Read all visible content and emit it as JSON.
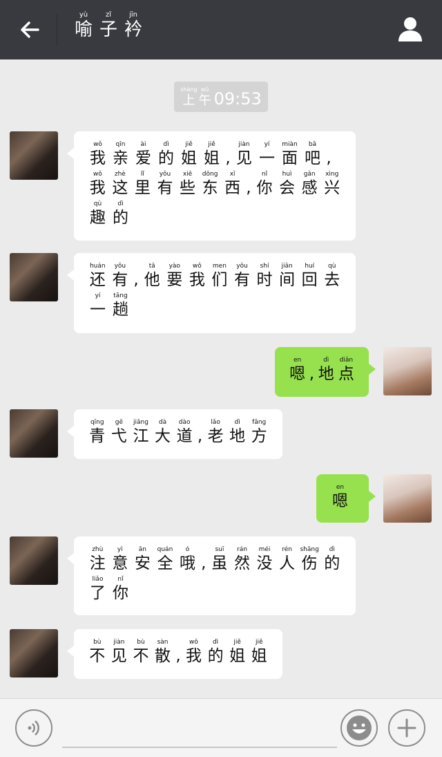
{
  "header": {
    "back_icon": "arrow-left-icon",
    "title": [
      {
        "py": "yù",
        "hz": "喻"
      },
      {
        "py": "zǐ",
        "hz": "子"
      },
      {
        "py": "jīn",
        "hz": "衿"
      }
    ],
    "profile_icon": "person-icon"
  },
  "timestamp": {
    "chars": [
      {
        "py": "shàng",
        "hz": "上"
      },
      {
        "py": "wǔ",
        "hz": "午"
      }
    ],
    "time": "09:53"
  },
  "messages": [
    {
      "side": "left",
      "lines": [
        [
          {
            "py": "wǒ",
            "hz": "我"
          },
          {
            "py": "qīn",
            "hz": "亲"
          },
          {
            "py": "ài",
            "hz": "爱"
          },
          {
            "py": "dì",
            "hz": "的"
          },
          {
            "py": "jiě",
            "hz": "姐"
          },
          {
            "py": "jiě",
            "hz": "姐"
          },
          {
            "py": "",
            "hz": ","
          },
          {
            "py": "jiàn",
            "hz": "见"
          },
          {
            "py": "yí",
            "hz": "一"
          },
          {
            "py": "miàn",
            "hz": "面"
          },
          {
            "py": "bā",
            "hz": "吧"
          },
          {
            "py": "",
            "hz": ","
          }
        ],
        [
          {
            "py": "wǒ",
            "hz": "我"
          },
          {
            "py": "zhè",
            "hz": "这"
          },
          {
            "py": "lǐ",
            "hz": "里"
          },
          {
            "py": "yǒu",
            "hz": "有"
          },
          {
            "py": "xiē",
            "hz": "些"
          },
          {
            "py": "dōng",
            "hz": "东"
          },
          {
            "py": "xī",
            "hz": "西"
          },
          {
            "py": "",
            "hz": ","
          },
          {
            "py": "nǐ",
            "hz": "你"
          },
          {
            "py": "huì",
            "hz": "会"
          },
          {
            "py": "gǎn",
            "hz": "感"
          },
          {
            "py": "xìng",
            "hz": "兴"
          }
        ],
        [
          {
            "py": "qù",
            "hz": "趣"
          },
          {
            "py": "dì",
            "hz": "的"
          }
        ]
      ]
    },
    {
      "side": "left",
      "lines": [
        [
          {
            "py": "huán",
            "hz": "还"
          },
          {
            "py": "yǒu",
            "hz": "有"
          },
          {
            "py": "",
            "hz": ","
          },
          {
            "py": "tā",
            "hz": "他"
          },
          {
            "py": "yào",
            "hz": "要"
          },
          {
            "py": "wǒ",
            "hz": "我"
          },
          {
            "py": "men",
            "hz": "们"
          },
          {
            "py": "yǒu",
            "hz": "有"
          },
          {
            "py": "shí",
            "hz": "时"
          },
          {
            "py": "jiān",
            "hz": "间"
          },
          {
            "py": "huí",
            "hz": "回"
          },
          {
            "py": "qù",
            "hz": "去"
          }
        ],
        [
          {
            "py": "yí",
            "hz": "一"
          },
          {
            "py": "tāng",
            "hz": "趟"
          }
        ]
      ]
    },
    {
      "side": "right",
      "lines": [
        [
          {
            "py": "en",
            "hz": "嗯"
          },
          {
            "py": "",
            "hz": ","
          },
          {
            "py": "dì",
            "hz": "地"
          },
          {
            "py": "diǎn",
            "hz": "点"
          }
        ]
      ]
    },
    {
      "side": "left",
      "lines": [
        [
          {
            "py": "qīng",
            "hz": "青"
          },
          {
            "py": "gē",
            "hz": "弋"
          },
          {
            "py": "jiāng",
            "hz": "江"
          },
          {
            "py": "dà",
            "hz": "大"
          },
          {
            "py": "dào",
            "hz": "道"
          },
          {
            "py": "",
            "hz": ","
          },
          {
            "py": "lǎo",
            "hz": "老"
          },
          {
            "py": "dì",
            "hz": "地"
          },
          {
            "py": "fāng",
            "hz": "方"
          }
        ]
      ]
    },
    {
      "side": "right",
      "lines": [
        [
          {
            "py": "en",
            "hz": "嗯"
          }
        ]
      ]
    },
    {
      "side": "left",
      "lines": [
        [
          {
            "py": "zhù",
            "hz": "注"
          },
          {
            "py": "yì",
            "hz": "意"
          },
          {
            "py": "ān",
            "hz": "安"
          },
          {
            "py": "quán",
            "hz": "全"
          },
          {
            "py": "ó",
            "hz": "哦"
          },
          {
            "py": "",
            "hz": ","
          },
          {
            "py": "suī",
            "hz": "虽"
          },
          {
            "py": "rán",
            "hz": "然"
          },
          {
            "py": "méi",
            "hz": "没"
          },
          {
            "py": "rén",
            "hz": "人"
          },
          {
            "py": "shāng",
            "hz": "伤"
          },
          {
            "py": "dì",
            "hz": "的"
          }
        ],
        [
          {
            "py": "liǎo",
            "hz": "了"
          },
          {
            "py": "nǐ",
            "hz": "你"
          }
        ]
      ]
    },
    {
      "side": "left",
      "lines": [
        [
          {
            "py": "bù",
            "hz": "不"
          },
          {
            "py": "jiàn",
            "hz": "见"
          },
          {
            "py": "bù",
            "hz": "不"
          },
          {
            "py": "sàn",
            "hz": "散"
          },
          {
            "py": "",
            "hz": ","
          },
          {
            "py": "wǒ",
            "hz": "我"
          },
          {
            "py": "dì",
            "hz": "的"
          },
          {
            "py": "jiě",
            "hz": "姐"
          },
          {
            "py": "jiě",
            "hz": "姐"
          }
        ]
      ]
    }
  ],
  "bottombar": {
    "voice_icon": "voice-icon",
    "emoji_icon": "smiley-icon",
    "plus_icon": "plus-icon"
  },
  "colors": {
    "header_bg": "#393a3f",
    "chat_bg": "#ebebeb",
    "green_bubble": "#97e14e",
    "white_bubble": "#ffffff"
  }
}
